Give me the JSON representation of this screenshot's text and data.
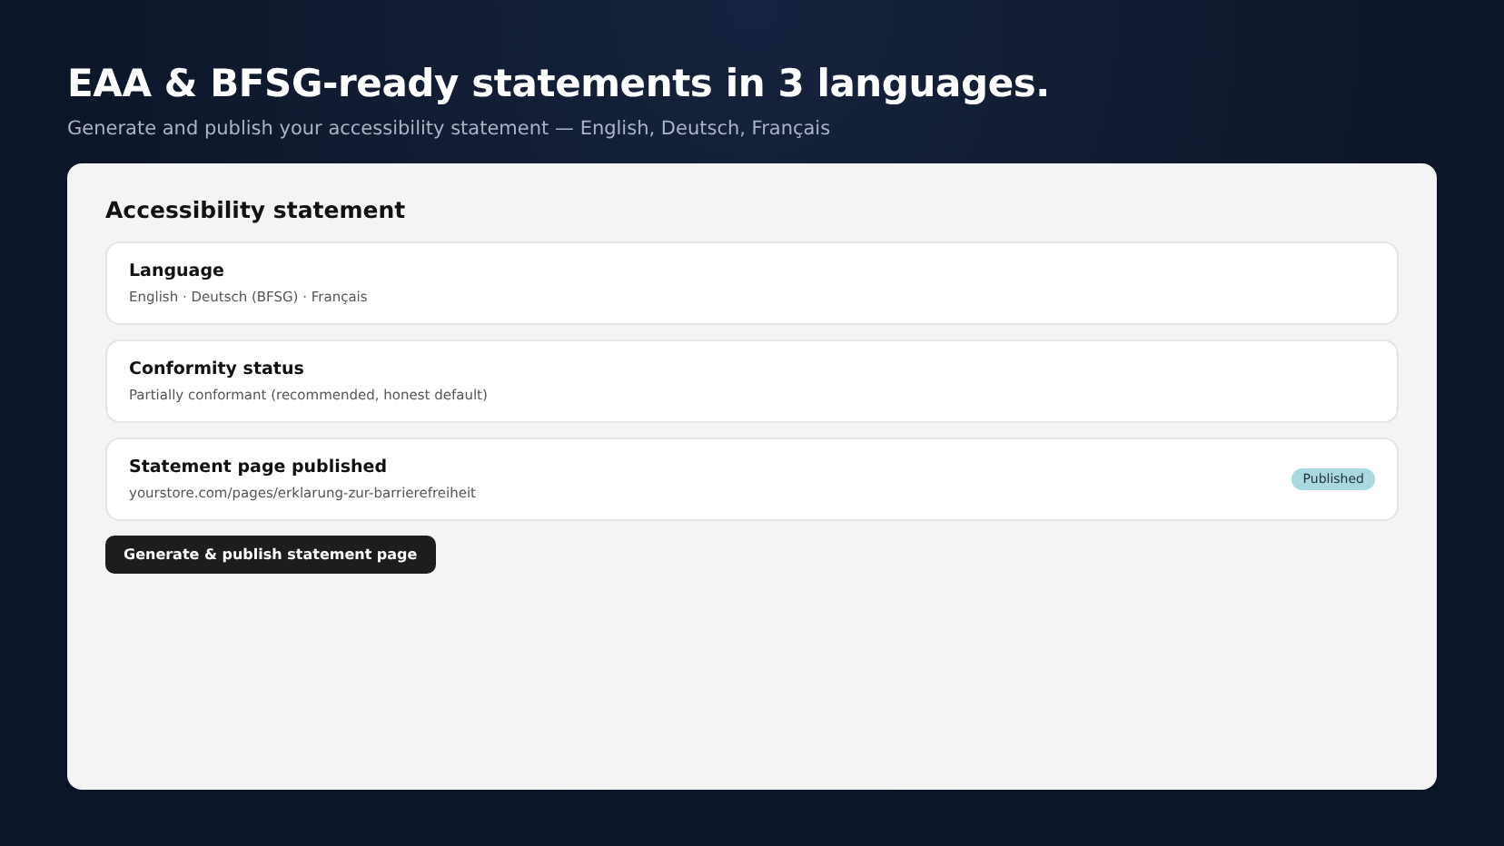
{
  "hero": {
    "title": "EAA & BFSG-ready statements in 3 languages.",
    "subtitle": "Generate and publish your accessibility statement — English, Deutsch, Français"
  },
  "panel": {
    "heading": "Accessibility statement",
    "rows": [
      {
        "label": "Language",
        "value": "English · Deutsch (BFSG) · Français"
      },
      {
        "label": "Conformity status",
        "value": "Partially conformant (recommended, honest default)"
      },
      {
        "label": "Statement page published",
        "value": "yourstore.com/pages/erklarung-zur-barrierefreiheit",
        "badge": "Published"
      }
    ],
    "button": "Generate & publish statement page"
  }
}
